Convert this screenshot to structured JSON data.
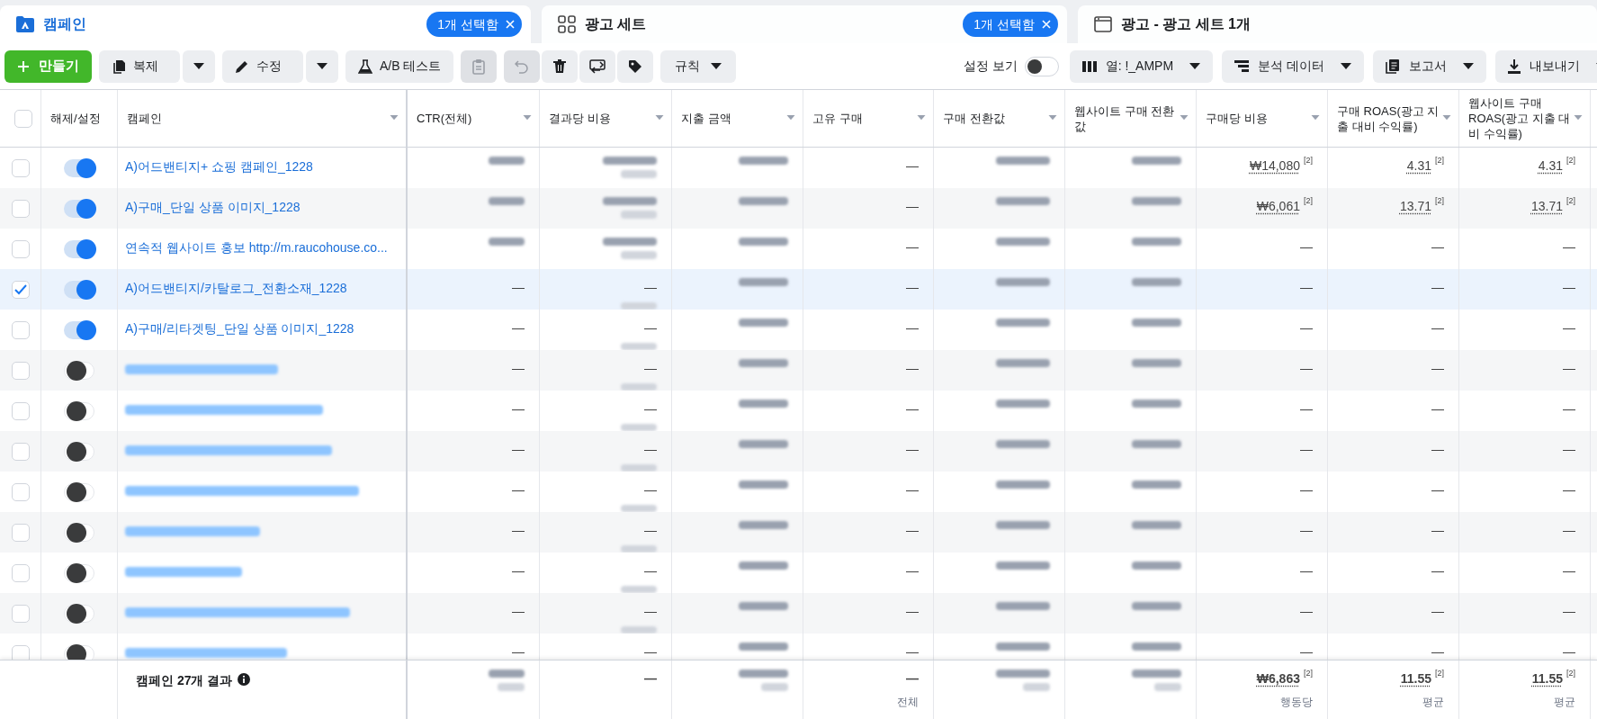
{
  "tabs": [
    {
      "label": "캠페인",
      "selected": true,
      "badge": "1개 선택함"
    },
    {
      "label": "광고 세트",
      "selected": false,
      "badge": "1개 선택함"
    },
    {
      "label": "광고 - 광고 세트 1개",
      "selected": false
    }
  ],
  "toolbar": {
    "left": [
      {
        "kind": "primary",
        "label": "만들기"
      },
      {
        "kind": "split",
        "label": "복제"
      },
      {
        "kind": "split",
        "label": "수정"
      },
      {
        "kind": "button",
        "label": "A/B 테스트"
      },
      {
        "kind": "icon_group",
        "buttons": [
          {
            "disabled": true
          }
        ]
      },
      {
        "kind": "icon_group",
        "buttons": [
          {
            "disabled": true
          },
          {
            "disabled": false
          },
          {
            "disabled": false
          },
          {
            "disabled": false
          }
        ]
      },
      {
        "kind": "dropdown",
        "label": "규칙"
      }
    ],
    "right": [
      {
        "kind": "switch",
        "label": "설정 보기",
        "on": false
      },
      {
        "kind": "dropdown",
        "label": "열: !_AMPM"
      },
      {
        "kind": "dropdown",
        "label": "분석 데이터"
      },
      {
        "kind": "dropdown",
        "label": "보고서"
      },
      {
        "kind": "dropdown",
        "label": "내보내기"
      }
    ]
  },
  "table": {
    "columns": [
      {
        "kind": "checkbox",
        "checked": false
      },
      {
        "kind": "text",
        "label": "해제/설정"
      },
      {
        "kind": "text",
        "label": "캠페인",
        "sortable": true
      },
      {
        "kind": "text",
        "label": "CTR(전체)",
        "sortable": true
      },
      {
        "kind": "text",
        "label": "결과당 비용",
        "sortable": true
      },
      {
        "kind": "text",
        "label": "지출 금액",
        "sortable": true
      },
      {
        "kind": "text",
        "label": "고유 구매",
        "sortable": true
      },
      {
        "kind": "text",
        "label": "구매 전환값",
        "sortable": true
      },
      {
        "kind": "text",
        "label": "웹사이트 구매 전환값",
        "sortable": true
      },
      {
        "kind": "text",
        "label": "구매당 비용",
        "sortable": true
      },
      {
        "kind": "text",
        "label": "구매 ROAS(광고 지출 대비 수익률)",
        "sortable": true
      },
      {
        "kind": "text",
        "label": "웹사이트 구매 ROAS(광고 지출 대비 수익률)",
        "sortable": true
      }
    ],
    "rows": [
      {
        "selected": false,
        "on": true,
        "name": {
          "kind": "text",
          "text": "A)어드밴티지+ 쇼핑 캠페인_1228"
        },
        "cells": [
          {
            "main": {
              "kind": "blurred"
            }
          },
          {
            "main": {
              "kind": "blurred"
            },
            "sub": {
              "kind": "blurred"
            }
          },
          {
            "main": {
              "kind": "blurred"
            }
          },
          {
            "main": {
              "kind": "text",
              "text": "—"
            }
          },
          {
            "main": {
              "kind": "blurred"
            }
          },
          {
            "main": {
              "kind": "blurred"
            }
          },
          {
            "main": {
              "kind": "text",
              "text": "₩14,080",
              "note": "[2]"
            }
          },
          {
            "main": {
              "kind": "text",
              "text": "4.31",
              "note": "[2]"
            }
          },
          {
            "main": {
              "kind": "text",
              "text": "4.31",
              "note": "[2]"
            }
          }
        ]
      },
      {
        "selected": false,
        "on": true,
        "name": {
          "kind": "text",
          "text": "A)구매_단일 상품 이미지_1228"
        },
        "cells": [
          {
            "main": {
              "kind": "blurred"
            }
          },
          {
            "main": {
              "kind": "blurred"
            },
            "sub": {
              "kind": "blurred"
            }
          },
          {
            "main": {
              "kind": "blurred"
            }
          },
          {
            "main": {
              "kind": "text",
              "text": "—"
            }
          },
          {
            "main": {
              "kind": "blurred"
            }
          },
          {
            "main": {
              "kind": "blurred"
            }
          },
          {
            "main": {
              "kind": "text",
              "text": "₩6,061",
              "note": "[2]"
            }
          },
          {
            "main": {
              "kind": "text",
              "text": "13.71",
              "note": "[2]"
            }
          },
          {
            "main": {
              "kind": "text",
              "text": "13.71",
              "note": "[2]"
            }
          }
        ]
      },
      {
        "selected": false,
        "on": true,
        "name": {
          "kind": "text",
          "text": "연속적 웹사이트 홍보 http://m.raucohouse.co..."
        },
        "cells": [
          {
            "main": {
              "kind": "blurred"
            }
          },
          {
            "main": {
              "kind": "blurred"
            },
            "sub": {
              "kind": "blurred"
            }
          },
          {
            "main": {
              "kind": "blurred"
            }
          },
          {
            "main": {
              "kind": "text",
              "text": "—"
            }
          },
          {
            "main": {
              "kind": "blurred"
            }
          },
          {
            "main": {
              "kind": "blurred"
            }
          },
          {
            "main": {
              "kind": "text",
              "text": "—"
            }
          },
          {
            "main": {
              "kind": "text",
              "text": "—"
            }
          },
          {
            "main": {
              "kind": "text",
              "text": "—"
            }
          }
        ]
      },
      {
        "selected": true,
        "on": true,
        "name": {
          "kind": "text",
          "text": "A)어드밴티지/카탈로그_전환소재_1228"
        },
        "cells": [
          {
            "main": {
              "kind": "text",
              "text": "—"
            }
          },
          {
            "main": {
              "kind": "text",
              "text": "—"
            },
            "sub": {
              "kind": "blurred"
            }
          },
          {
            "main": {
              "kind": "blurred"
            }
          },
          {
            "main": {
              "kind": "text",
              "text": "—"
            }
          },
          {
            "main": {
              "kind": "blurred"
            }
          },
          {
            "main": {
              "kind": "blurred"
            }
          },
          {
            "main": {
              "kind": "text",
              "text": "—"
            }
          },
          {
            "main": {
              "kind": "text",
              "text": "—"
            }
          },
          {
            "main": {
              "kind": "text",
              "text": "—"
            }
          }
        ]
      },
      {
        "selected": false,
        "on": true,
        "name": {
          "kind": "text",
          "text": "A)구매/리타겟팅_단일 상품 이미지_1228"
        },
        "cells": [
          {
            "main": {
              "kind": "text",
              "text": "—"
            }
          },
          {
            "main": {
              "kind": "text",
              "text": "—"
            },
            "sub": {
              "kind": "blurred"
            }
          },
          {
            "main": {
              "kind": "blurred"
            }
          },
          {
            "main": {
              "kind": "text",
              "text": "—"
            }
          },
          {
            "main": {
              "kind": "blurred"
            }
          },
          {
            "main": {
              "kind": "blurred"
            }
          },
          {
            "main": {
              "kind": "text",
              "text": "—"
            }
          },
          {
            "main": {
              "kind": "text",
              "text": "—"
            }
          },
          {
            "main": {
              "kind": "text",
              "text": "—"
            }
          }
        ]
      },
      {
        "selected": false,
        "on": false,
        "name": {
          "kind": "blurred"
        },
        "cells": [
          {
            "main": {
              "kind": "text",
              "text": "—"
            }
          },
          {
            "main": {
              "kind": "text",
              "text": "—"
            },
            "sub": {
              "kind": "blurred"
            }
          },
          {
            "main": {
              "kind": "blurred"
            }
          },
          {
            "main": {
              "kind": "text",
              "text": "—"
            }
          },
          {
            "main": {
              "kind": "blurred"
            }
          },
          {
            "main": {
              "kind": "blurred"
            }
          },
          {
            "main": {
              "kind": "text",
              "text": "—"
            }
          },
          {
            "main": {
              "kind": "text",
              "text": "—"
            }
          },
          {
            "main": {
              "kind": "text",
              "text": "—"
            }
          }
        ]
      },
      {
        "selected": false,
        "on": false,
        "name": {
          "kind": "blurred"
        },
        "cells": [
          {
            "main": {
              "kind": "text",
              "text": "—"
            }
          },
          {
            "main": {
              "kind": "text",
              "text": "—"
            },
            "sub": {
              "kind": "blurred"
            }
          },
          {
            "main": {
              "kind": "blurred"
            }
          },
          {
            "main": {
              "kind": "text",
              "text": "—"
            }
          },
          {
            "main": {
              "kind": "blurred"
            }
          },
          {
            "main": {
              "kind": "blurred"
            }
          },
          {
            "main": {
              "kind": "text",
              "text": "—"
            }
          },
          {
            "main": {
              "kind": "text",
              "text": "—"
            }
          },
          {
            "main": {
              "kind": "text",
              "text": "—"
            }
          }
        ]
      },
      {
        "selected": false,
        "on": false,
        "name": {
          "kind": "blurred"
        },
        "cells": [
          {
            "main": {
              "kind": "text",
              "text": "—"
            }
          },
          {
            "main": {
              "kind": "text",
              "text": "—"
            },
            "sub": {
              "kind": "blurred"
            }
          },
          {
            "main": {
              "kind": "blurred"
            }
          },
          {
            "main": {
              "kind": "text",
              "text": "—"
            }
          },
          {
            "main": {
              "kind": "blurred"
            }
          },
          {
            "main": {
              "kind": "blurred"
            }
          },
          {
            "main": {
              "kind": "text",
              "text": "—"
            }
          },
          {
            "main": {
              "kind": "text",
              "text": "—"
            }
          },
          {
            "main": {
              "kind": "text",
              "text": "—"
            }
          }
        ]
      },
      {
        "selected": false,
        "on": false,
        "name": {
          "kind": "blurred"
        },
        "cells": [
          {
            "main": {
              "kind": "text",
              "text": "—"
            }
          },
          {
            "main": {
              "kind": "text",
              "text": "—"
            },
            "sub": {
              "kind": "blurred"
            }
          },
          {
            "main": {
              "kind": "blurred"
            }
          },
          {
            "main": {
              "kind": "text",
              "text": "—"
            }
          },
          {
            "main": {
              "kind": "blurred"
            }
          },
          {
            "main": {
              "kind": "blurred"
            }
          },
          {
            "main": {
              "kind": "text",
              "text": "—"
            }
          },
          {
            "main": {
              "kind": "text",
              "text": "—"
            }
          },
          {
            "main": {
              "kind": "text",
              "text": "—"
            }
          }
        ]
      },
      {
        "selected": false,
        "on": false,
        "name": {
          "kind": "blurred"
        },
        "cells": [
          {
            "main": {
              "kind": "text",
              "text": "—"
            }
          },
          {
            "main": {
              "kind": "text",
              "text": "—"
            },
            "sub": {
              "kind": "blurred"
            }
          },
          {
            "main": {
              "kind": "blurred"
            }
          },
          {
            "main": {
              "kind": "text",
              "text": "—"
            }
          },
          {
            "main": {
              "kind": "blurred"
            }
          },
          {
            "main": {
              "kind": "blurred"
            }
          },
          {
            "main": {
              "kind": "text",
              "text": "—"
            }
          },
          {
            "main": {
              "kind": "text",
              "text": "—"
            }
          },
          {
            "main": {
              "kind": "text",
              "text": "—"
            }
          }
        ]
      },
      {
        "selected": false,
        "on": false,
        "name": {
          "kind": "blurred"
        },
        "cells": [
          {
            "main": {
              "kind": "text",
              "text": "—"
            }
          },
          {
            "main": {
              "kind": "text",
              "text": "—"
            },
            "sub": {
              "kind": "blurred"
            }
          },
          {
            "main": {
              "kind": "blurred"
            }
          },
          {
            "main": {
              "kind": "text",
              "text": "—"
            }
          },
          {
            "main": {
              "kind": "blurred"
            }
          },
          {
            "main": {
              "kind": "blurred"
            }
          },
          {
            "main": {
              "kind": "text",
              "text": "—"
            }
          },
          {
            "main": {
              "kind": "text",
              "text": "—"
            }
          },
          {
            "main": {
              "kind": "text",
              "text": "—"
            }
          }
        ]
      },
      {
        "selected": false,
        "on": false,
        "name": {
          "kind": "blurred"
        },
        "cells": [
          {
            "main": {
              "kind": "text",
              "text": "—"
            }
          },
          {
            "main": {
              "kind": "text",
              "text": "—"
            },
            "sub": {
              "kind": "blurred"
            }
          },
          {
            "main": {
              "kind": "blurred"
            }
          },
          {
            "main": {
              "kind": "text",
              "text": "—"
            }
          },
          {
            "main": {
              "kind": "blurred"
            }
          },
          {
            "main": {
              "kind": "blurred"
            }
          },
          {
            "main": {
              "kind": "text",
              "text": "—"
            }
          },
          {
            "main": {
              "kind": "text",
              "text": "—"
            }
          },
          {
            "main": {
              "kind": "text",
              "text": "—"
            }
          }
        ]
      },
      {
        "selected": false,
        "on": false,
        "name": {
          "kind": "blurred"
        },
        "cells": [
          {
            "main": {
              "kind": "text",
              "text": "—"
            }
          },
          {
            "main": {
              "kind": "text",
              "text": "—"
            }
          },
          {
            "main": {
              "kind": "blurred"
            }
          },
          {
            "main": {
              "kind": "text",
              "text": "—"
            }
          },
          {
            "main": {
              "kind": "blurred"
            }
          },
          {
            "main": {
              "kind": "blurred"
            }
          },
          {
            "main": {
              "kind": "text",
              "text": "—"
            }
          },
          {
            "main": {
              "kind": "text",
              "text": "—"
            }
          },
          {
            "main": {
              "kind": "text",
              "text": "—"
            }
          }
        ]
      }
    ],
    "footer": {
      "label": "캠페인 27개 결과",
      "cells": [
        {
          "main": {
            "kind": "blurred"
          },
          "sub": {
            "kind": "blurred"
          }
        },
        {
          "main": {
            "kind": "text",
            "text": "—"
          }
        },
        {
          "main": {
            "kind": "blurred"
          },
          "sub": {
            "kind": "blurred"
          }
        },
        {
          "main": {
            "kind": "text",
            "text": "—"
          },
          "sub": {
            "kind": "text",
            "text": "전체"
          }
        },
        {
          "main": {
            "kind": "blurred"
          },
          "sub": {
            "kind": "blurred"
          }
        },
        {
          "main": {
            "kind": "blurred"
          },
          "sub": {
            "kind": "blurred"
          }
        },
        {
          "main": {
            "kind": "text",
            "text": "₩6,863",
            "note": "[2]"
          },
          "sub": {
            "kind": "text",
            "text": "행동당"
          }
        },
        {
          "main": {
            "kind": "text",
            "text": "11.55",
            "note": "[2]"
          },
          "sub": {
            "kind": "text",
            "text": "평균"
          }
        },
        {
          "main": {
            "kind": "text",
            "text": "11.55",
            "note": "[2]"
          },
          "sub": {
            "kind": "text",
            "text": "평균"
          }
        }
      ]
    }
  }
}
